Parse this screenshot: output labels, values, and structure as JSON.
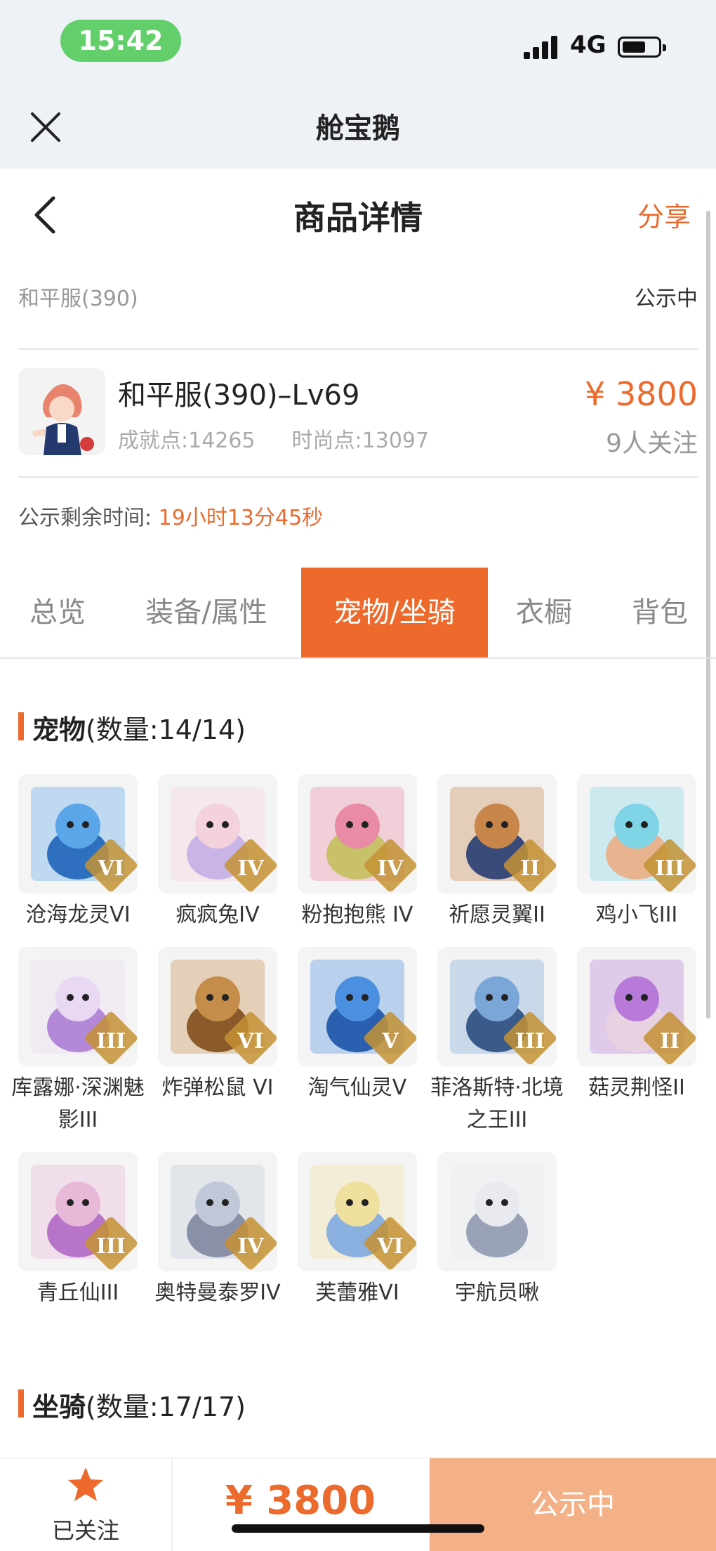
{
  "status_bar": {
    "time": "15:42",
    "network": "4G"
  },
  "app_bar": {
    "title": "舱宝鹅"
  },
  "nav": {
    "title": "商品详情",
    "share": "分享"
  },
  "server": {
    "name": "和平服(390)",
    "status": "公示中"
  },
  "product": {
    "name": "和平服(390)–Lv69",
    "achievement": "成就点:14265",
    "fashion": "时尚点:13097",
    "price": "¥ 3800",
    "followers": "9人关注"
  },
  "countdown": {
    "label": "公示剩余时间:",
    "value": "19小时13分45秒"
  },
  "tabs": [
    "总览",
    "装备/属性",
    "宠物/坐骑",
    "衣橱",
    "背包"
  ],
  "pets_section": {
    "title": "宠物",
    "count": "(数量:14/14)"
  },
  "pets": [
    {
      "name": "沧海龙灵VI",
      "badge": "VI"
    },
    {
      "name": "疯疯兔IV",
      "badge": "IV"
    },
    {
      "name": "粉抱抱熊 IV",
      "badge": "IV"
    },
    {
      "name": "祈愿灵翼II",
      "badge": "II"
    },
    {
      "name": "鸡小飞III",
      "badge": "III"
    },
    {
      "name": "库露娜·深渊魅影III",
      "badge": "III"
    },
    {
      "name": "炸弹松鼠 VI",
      "badge": "VI"
    },
    {
      "name": "淘气仙灵V",
      "badge": "V"
    },
    {
      "name": "菲洛斯特·北境之王III",
      "badge": "III"
    },
    {
      "name": "菇灵荆怪II",
      "badge": "II"
    },
    {
      "name": "青丘仙III",
      "badge": "III"
    },
    {
      "name": "奥特曼泰罗IV",
      "badge": "IV"
    },
    {
      "name": "芙蕾雅VI",
      "badge": "VI"
    },
    {
      "name": "宇航员啾",
      "badge": ""
    }
  ],
  "mounts_section": {
    "title": "坐骑",
    "count": "(数量:17/17)"
  },
  "bottom_bar": {
    "follow_label": "已关注",
    "price": "¥ 3800",
    "action": "公示中"
  },
  "colors": {
    "accent": "#ee6a2c",
    "status_green": "#62cf6b",
    "action_disabled": "#f4b187"
  }
}
